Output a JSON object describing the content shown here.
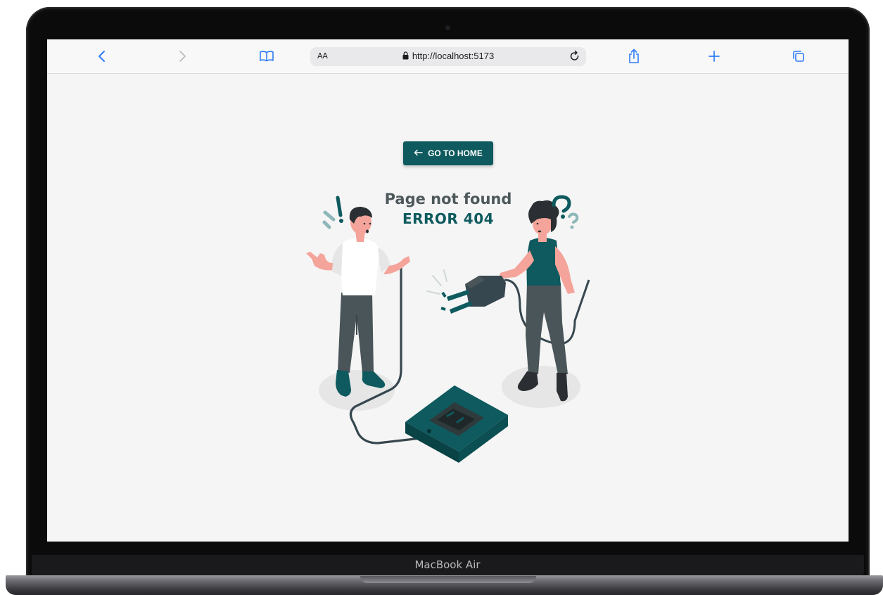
{
  "device": {
    "label": "MacBook Air"
  },
  "browser": {
    "text_size_label": "AA",
    "url": "http://localhost:5173",
    "icons": [
      "back-icon",
      "forward-icon",
      "bookmarks-icon",
      "lock-icon",
      "reload-icon",
      "share-icon",
      "new-tab-icon",
      "tabs-icon"
    ]
  },
  "page": {
    "home_button_label": "GO TO HOME",
    "title": "Page not found",
    "error_code": "ERROR 404",
    "illustration": "people-unplugged-cable",
    "colors": {
      "accent": "#0e5a5e",
      "text": "#4d585b",
      "background": "#f5f5f5",
      "skin": "#f4a49a"
    }
  }
}
